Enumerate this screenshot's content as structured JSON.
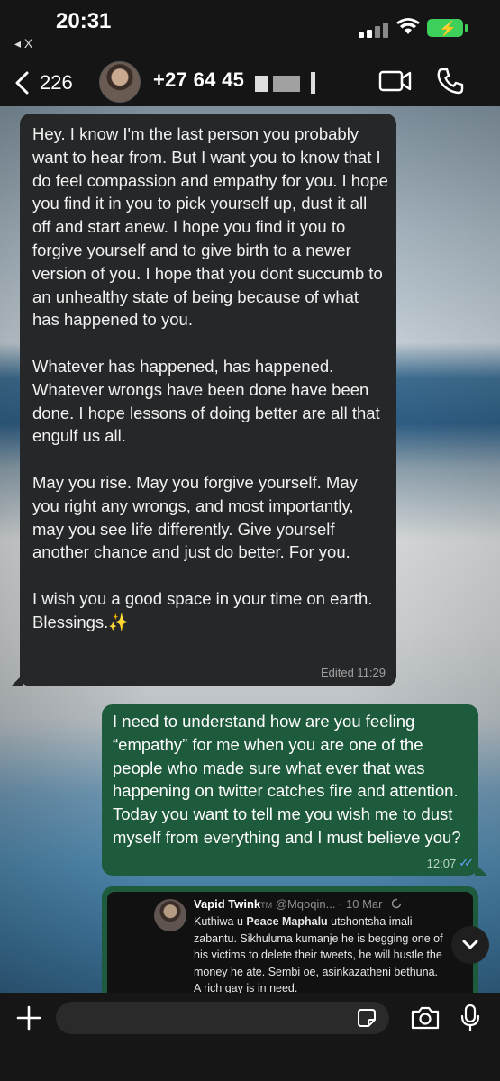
{
  "status_bar": {
    "time": "20:31",
    "back_app": "◂ X"
  },
  "header": {
    "unread_count": "226",
    "contact_number": "+27 64 45"
  },
  "messages": [
    {
      "direction": "incoming",
      "text": "Hey. I know I'm the last person you probably want to hear from. But I want you to know that I do feel compassion and empathy for you. I hope you find it in you to pick yourself up, dust it all off and start anew. I hope you find it you to forgive yourself and to give birth to a newer version of you. I hope that you dont succumb to an unhealthy state of being because of what has happened to you.\n\nWhatever has happened, has happened. Whatever wrongs have been done have been done. I hope lessons of doing better are all that engulf us all.\n\nMay you rise. May you forgive yourself. May you right any wrongs, and most importantly, may you see life differently. Give yourself another chance and just do better. For you.\n\nI wish you a good space in your time on earth. Blessings.✨",
      "meta": "Edited 11:29"
    },
    {
      "direction": "outgoing",
      "text": "I need to understand how are you feeling “empathy” for me when you are one of the people who made sure what ever that was happening on twitter catches fire and attention. Today you want to tell me you wish me to dust myself from everything and I must believe you?",
      "time": "12:07"
    }
  ],
  "quoted_tweet": {
    "name": "Vapid Twink",
    "tm": "TM",
    "handle_date": " @Mqoqin... · 10 Mar",
    "text_before": "Kuthiwa u ",
    "mention": "Peace Maphalu",
    "text_after": " utshontsha imali zabantu. Sikhuluma kumanje he is begging one of his victims to delete their tweets, he will hustle the money he ate. Sembi oe, asinkazatheni bethuna. A rich gay is in need."
  },
  "composer": {
    "placeholder": ""
  }
}
